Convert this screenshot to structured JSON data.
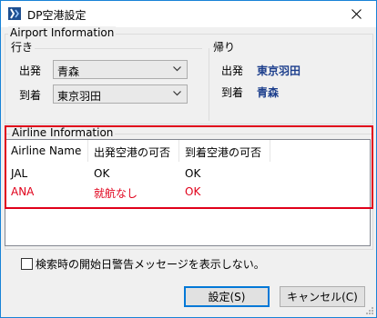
{
  "window": {
    "title": "DP空港設定"
  },
  "airport": {
    "group_label": "Airport Information",
    "outbound": {
      "label": "行き",
      "departure_label": "出発",
      "departure_value": "青森",
      "arrival_label": "到着",
      "arrival_value": "東京羽田"
    },
    "return": {
      "label": "帰り",
      "departure_label": "出発",
      "departure_value": "東京羽田",
      "arrival_label": "到着",
      "arrival_value": "青森"
    }
  },
  "airline": {
    "group_label": "Airline Information",
    "columns": [
      "Airline Name",
      "出発空港の可否",
      "到着空港の可否"
    ],
    "rows": [
      {
        "name": "JAL",
        "dep": "OK",
        "arr": "OK",
        "highlight": false
      },
      {
        "name": "ANA",
        "dep": "就航なし",
        "arr": "OK",
        "highlight": true
      }
    ]
  },
  "options": {
    "suppress_warning_label": "検索時の開始日警告メッセージを表示しない。",
    "suppress_warning_checked": false
  },
  "buttons": {
    "ok_label": "設定(S)",
    "cancel_label": "キャンセル(C)"
  },
  "colors": {
    "highlight_red": "#e0001a",
    "value_blue": "#1c3e8c",
    "accent": "#0078d7"
  }
}
